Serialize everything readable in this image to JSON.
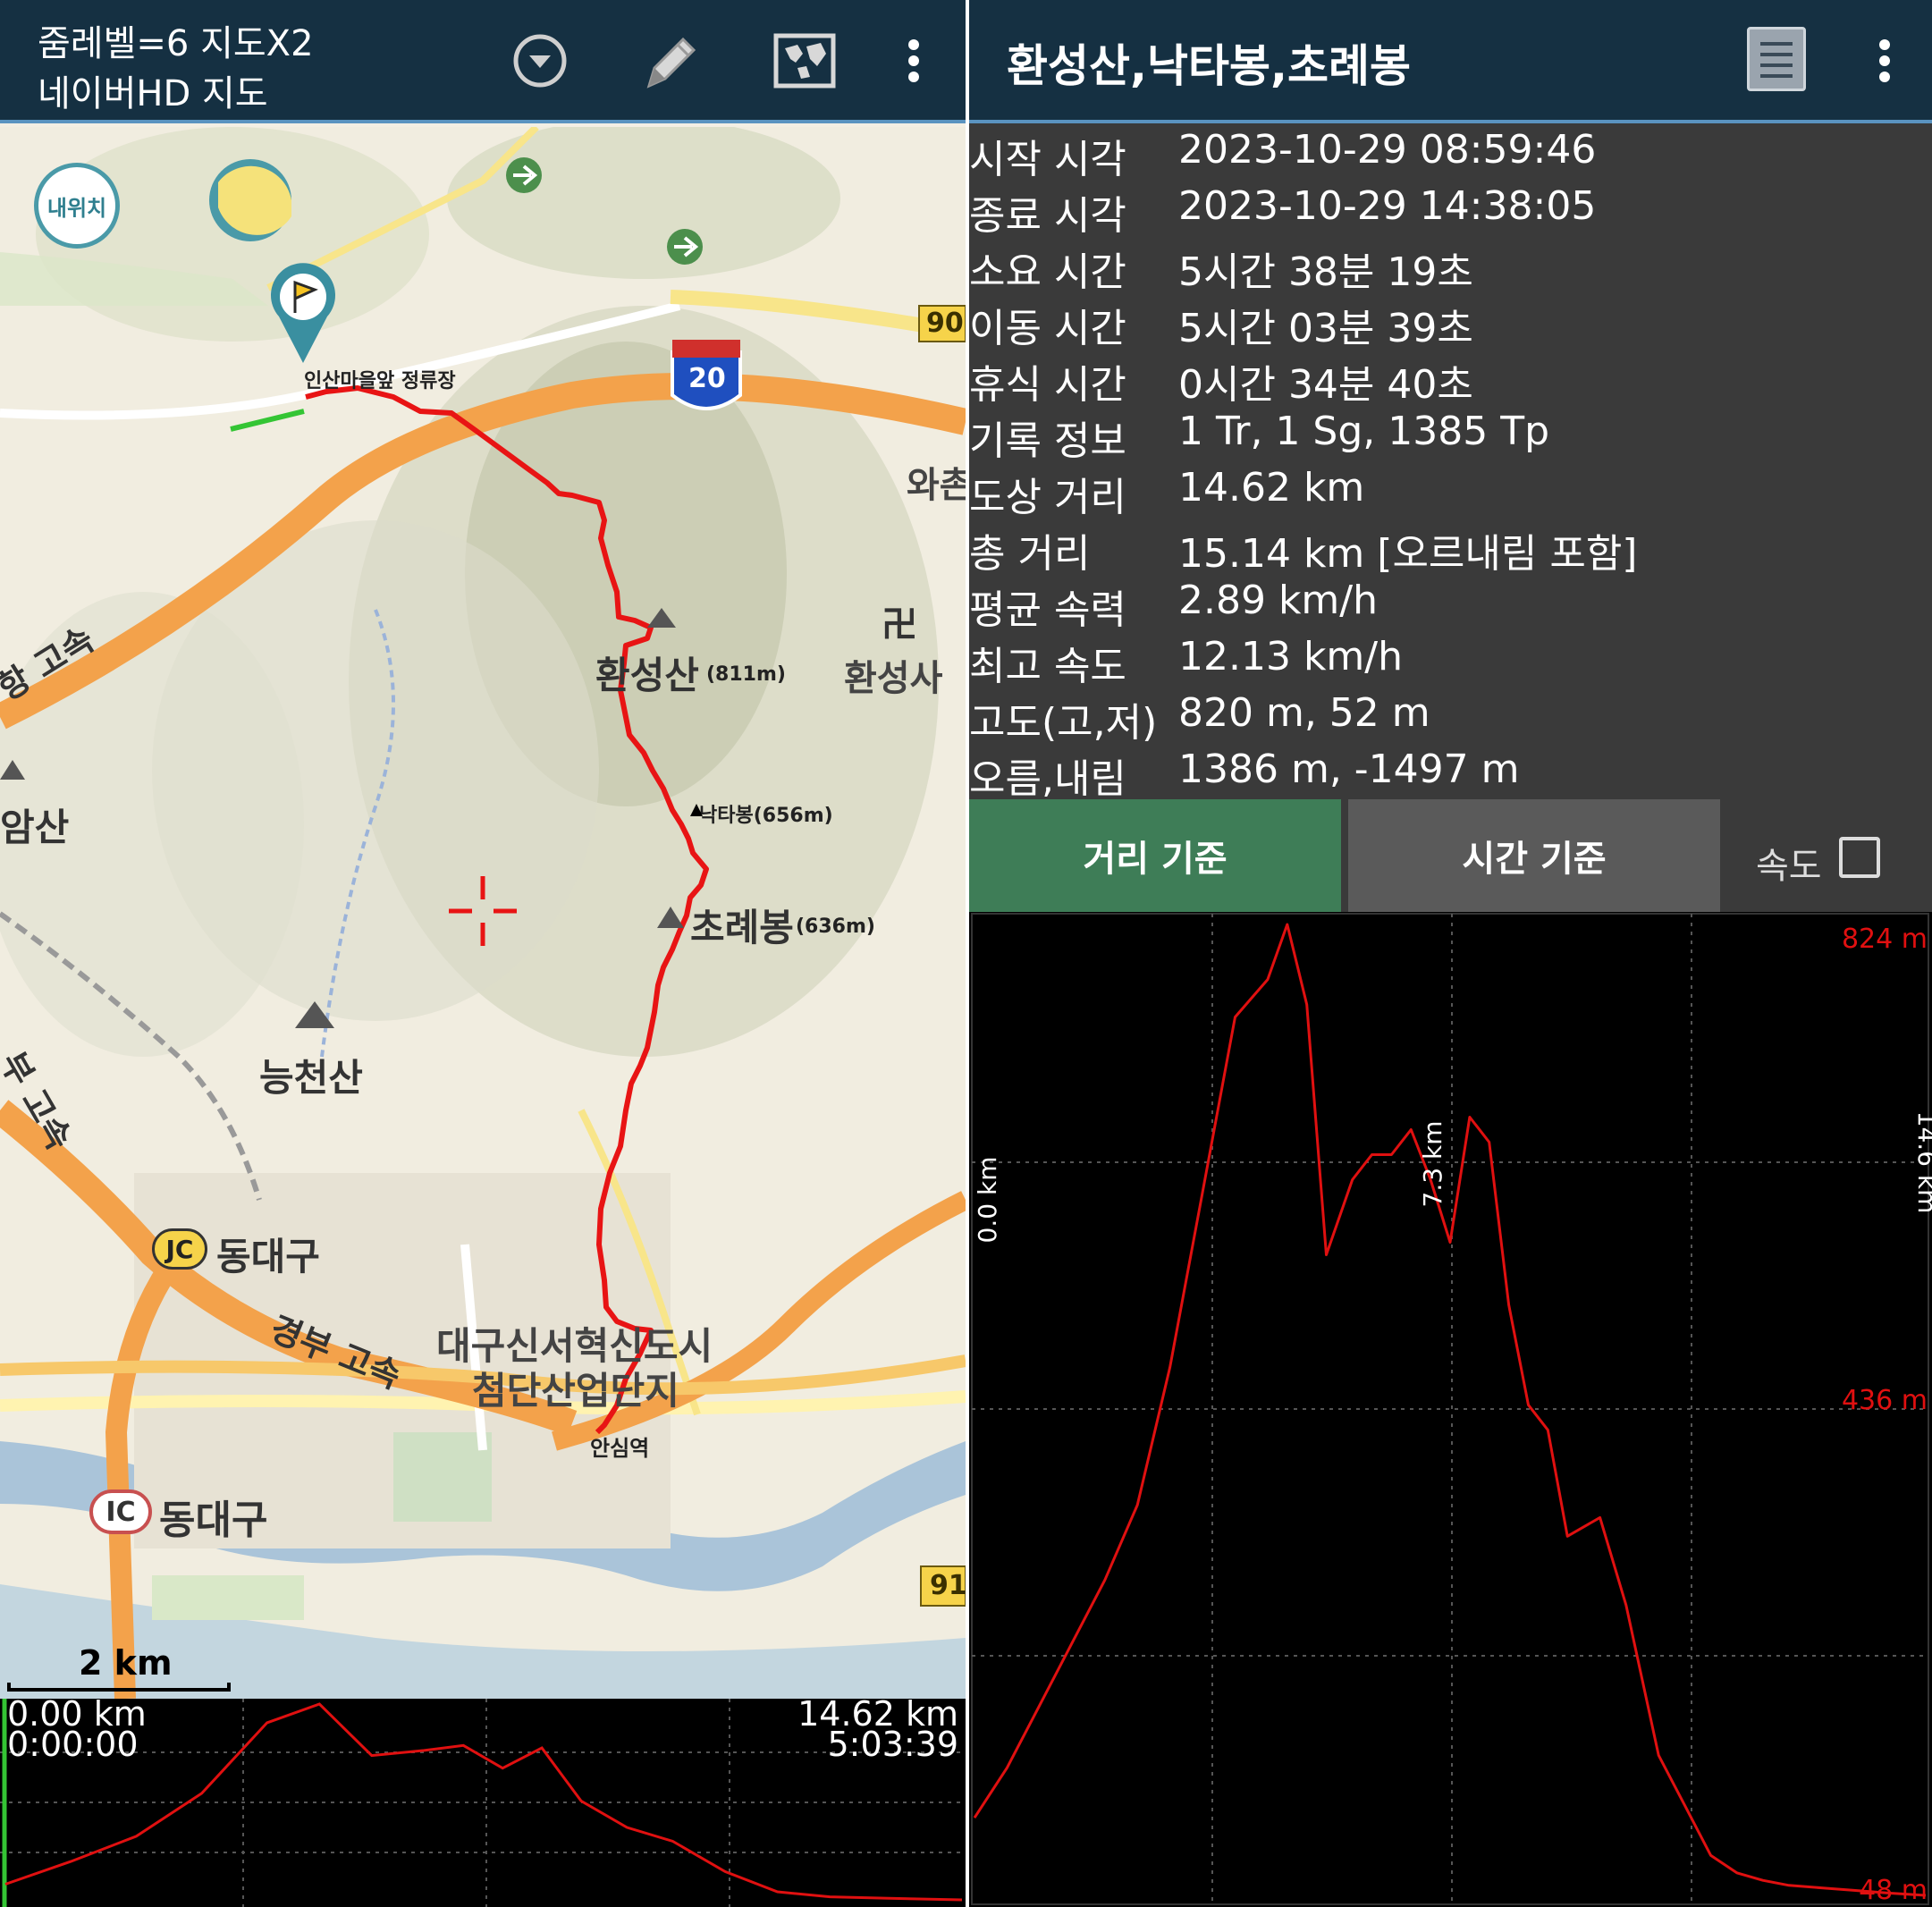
{
  "left_header": {
    "zoom_text": "줌레벨=6 지도X2",
    "map_source": "네이버HD 지도",
    "icons": [
      "dropdown-circle-icon",
      "pencil-icon",
      "world-map-icon",
      "more-vert-icon"
    ]
  },
  "map": {
    "my_location_label": "내위치",
    "start_label": "인산마을앞 정류장",
    "end_label": "안심역",
    "highway_shield": "20",
    "road_90": "90",
    "road_91": "91",
    "places": {
      "hwanseongsan": "환성산",
      "hwanseongsan_height": "(811m)",
      "naktabong": "낙타봉(656m)",
      "choryebong": "초례봉",
      "choryebong_height": "(636m)",
      "hwanseongsa": "환성사",
      "wachon": "와촌",
      "neungcheonsan": "능천산",
      "amsan": "암산",
      "jc_badge": "JC",
      "jc_name": "동대구",
      "ic_badge": "IC",
      "ic_name": "동대구",
      "gyeongbu": "경부 고속",
      "highway_left": "항 고속",
      "highway_left2": "부 고속",
      "innocity": "대구신서혁신도시",
      "industrial": "첨단산업단지",
      "temple_symbol": "卍"
    },
    "scale": "2 km"
  },
  "mini_profile": {
    "start_dist": "0.00 km",
    "start_time": "0:00:00",
    "end_dist": "14.62 km",
    "end_time": "5:03:39"
  },
  "right_header": {
    "title": "환성산,낙타봉,초례봉",
    "icons": [
      "list-icon",
      "more-vert-icon"
    ]
  },
  "info": [
    {
      "key": "시작 시각",
      "value": "2023-10-29 08:59:46"
    },
    {
      "key": "종료 시각",
      "value": "2023-10-29 14:38:05"
    },
    {
      "key": "소요 시간",
      "value": "5시간 38분 19초"
    },
    {
      "key": "이동 시간",
      "value": "5시간 03분 39초"
    },
    {
      "key": "휴식 시간",
      "value": "0시간 34분 40초"
    },
    {
      "key": "기록 정보",
      "value": "1 Tr, 1 Sg, 1385 Tp"
    },
    {
      "key": "도상 거리",
      "value": "14.62 km"
    },
    {
      "key": "총 거리",
      "value": "15.14 km [오르내림 포함]"
    },
    {
      "key": "평균 속력",
      "value": "2.89 km/h"
    },
    {
      "key": "최고 속도",
      "value": "12.13 km/h"
    },
    {
      "key": "고도(고,저)",
      "value": "820 m, 52 m"
    },
    {
      "key": "오름,내림",
      "value": "1386 m, -1497 m"
    }
  ],
  "tabs": {
    "distance": "거리 기준",
    "time": "시간 기준",
    "speed": "속도",
    "speed_checked": false
  },
  "chart_data": {
    "type": "line",
    "x_unit": "km",
    "y_unit": "m",
    "xlim": [
      0,
      14.6
    ],
    "ylim": [
      48,
      824
    ],
    "x_tick_labels": [
      "0.0 km",
      "7.3 km",
      "14.6 km"
    ],
    "y_tick_labels": [
      "824 m",
      "436 m",
      "48 m"
    ],
    "grid": true,
    "series": [
      {
        "color": "#e01010",
        "x": [
          0.0,
          0.5,
          1.0,
          1.5,
          2.0,
          2.5,
          3.0,
          3.5,
          4.0,
          4.5,
          4.8,
          5.1,
          5.4,
          5.8,
          6.1,
          6.4,
          6.7,
          7.0,
          7.3,
          7.6,
          7.9,
          8.2,
          8.5,
          8.8,
          9.1,
          9.6,
          10.0,
          10.5,
          10.9,
          11.3,
          11.7,
          12.1,
          12.5,
          13.0,
          13.5,
          14.0,
          14.6
        ],
        "y": [
          110,
          150,
          200,
          250,
          300,
          360,
          470,
          610,
          750,
          780,
          824,
          760,
          560,
          620,
          640,
          640,
          660,
          620,
          570,
          670,
          650,
          520,
          440,
          420,
          335,
          350,
          280,
          160,
          120,
          80,
          66,
          60,
          56,
          54,
          52,
          50,
          48
        ]
      }
    ]
  },
  "mini_chart_data": {
    "type": "line",
    "color": "#e01010",
    "x": [
      0.0,
      1.0,
      2.0,
      3.0,
      4.0,
      4.8,
      5.6,
      6.4,
      7.0,
      7.6,
      8.2,
      8.8,
      9.5,
      10.2,
      11.0,
      11.8,
      12.6,
      13.5,
      14.62
    ],
    "y": [
      110,
      200,
      300,
      470,
      750,
      824,
      620,
      640,
      660,
      570,
      650,
      440,
      335,
      280,
      160,
      80,
      60,
      54,
      48
    ],
    "ylim": [
      48,
      824
    ]
  }
}
